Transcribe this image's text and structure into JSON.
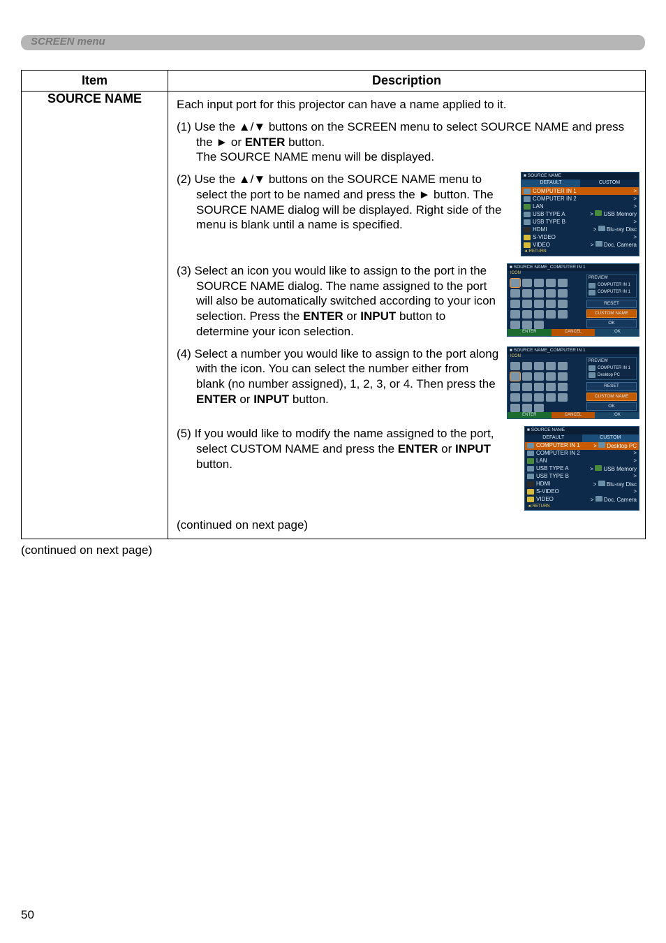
{
  "tab": {
    "label": "SCREEN menu"
  },
  "table": {
    "headers": {
      "item": "Item",
      "desc": "Description"
    },
    "item_label": "SOURCE NAME",
    "intro": "Each input port for this projector can have a name applied to it.",
    "step1_a": "(1) Use the ▲/▼ buttons on the SCREEN menu to select SOURCE NAME and press the ► or ",
    "step1_b": " button.",
    "step1_c": "The SOURCE NAME menu will be displayed.",
    "enter": "ENTER",
    "input": "INPUT",
    "step2": "(2) Use the ▲/▼ buttons on the SOURCE NAME menu to select the port to be named and press the ► button. The SOURCE NAME dialog will be displayed. Right side of the menu is blank until a name is specified.",
    "step3_a": "(3) Select an icon you would like to assign to the port in the SOURCE NAME dialog. The name assigned to the port will also be automatically switched according to your icon selection. Press the ",
    "step3_b": " or ",
    "step3_c": " button to determine your icon selection.",
    "step4_a": "(4) Select a number you would like to assign to the port along with the icon. You can select the number either from blank (no number assigned), 1, 2, 3, or 4. Then press the ",
    "step4_b": " or ",
    "step4_c": " button.",
    "step5_a": "(5) If you would like to modify the name assigned to the port, select CUSTOM NAME and press the ",
    "step5_b": " or ",
    "step5_c": " button.",
    "cont": "(continued on next page)"
  },
  "osd": {
    "title_source_name": "SOURCE NAME",
    "default": "DEFAULT",
    "custom": "CUSTOM",
    "comp1": "COMPUTER IN 1",
    "comp2": "COMPUTER IN 2",
    "lan": "LAN",
    "usba": "USB TYPE A",
    "usbb": "USB TYPE B",
    "hdmi": "HDMI",
    "svideo": "S-VIDEO",
    "video": "VIDEO",
    "return": "RETURN",
    "usb_mem": "USB Memory",
    "bluray": "Blu-ray Disc",
    "doc_cam": "Doc. Camera",
    "desktop": "Desktop PC",
    "preview": "PREVIEW",
    "reset": "RESET",
    "custom_name": "CUSTOM NAME",
    "cancel": "CANCEL",
    "ok": "OK",
    "enter": "ENTER",
    "icon": "ICON",
    "title_sn_comp1": "SOURCE NAME_COMPUTER IN 1"
  },
  "continued_outside": "(continued on next page)",
  "page_number": "50"
}
